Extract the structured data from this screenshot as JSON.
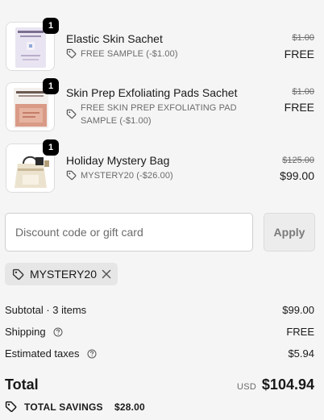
{
  "items": [
    {
      "image": "white sachet product thumbnail",
      "qty": "1",
      "name": "Elastic Skin Sachet",
      "discount": "FREE SAMPLE (-$1.00)",
      "original_price": "$1.00",
      "price": "FREE"
    },
    {
      "image": "pink exfoliating pads sachet thumbnail",
      "qty": "1",
      "name": "Skin Prep Exfoliating Pads Sachet",
      "discount": "FREE SKIN PREP EXFOLIATING PAD SAMPLE (-$1.00)",
      "original_price": "$1.00",
      "price": "FREE"
    },
    {
      "image": "holiday mystery tote bag thumbnail",
      "qty": "1",
      "name": "Holiday Mystery Bag",
      "discount": "MYSTERY20 (-$26.00)",
      "original_price": "$125.00",
      "price": "$99.00"
    }
  ],
  "discount_form": {
    "placeholder": "Discount code or gift card",
    "apply_label": "Apply"
  },
  "applied_code": "MYSTERY20",
  "summary": {
    "subtotal_label": "Subtotal · 3 items",
    "subtotal_value": "$99.00",
    "shipping_label": "Shipping",
    "shipping_value": "FREE",
    "taxes_label": "Estimated taxes",
    "taxes_value": "$5.94"
  },
  "total": {
    "label": "Total",
    "currency": "USD",
    "amount": "$104.94"
  },
  "savings": {
    "label": "TOTAL SAVINGS",
    "amount": "$28.00"
  },
  "icons": {
    "tag": "tag-icon",
    "close": "close-icon",
    "help": "question-circle-icon"
  },
  "colors": {
    "background": "#f5f5f5",
    "text": "#1a1a1a",
    "muted": "#6b6b6b",
    "badge": "#000000"
  }
}
